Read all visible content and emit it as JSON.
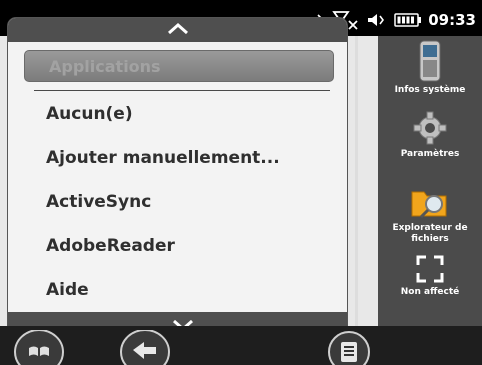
{
  "status_bar": {
    "time": "09:33",
    "icons": [
      "sync-icon",
      "signal-off-icon",
      "volume-icon",
      "battery-icon"
    ]
  },
  "tiles": [
    {
      "label": "Infos système",
      "icon": "device-icon"
    },
    {
      "label": "Paramètres",
      "icon": "gear-icon"
    },
    {
      "label": "Explorateur de fichiers",
      "icon": "folder-search-icon"
    },
    {
      "label": "Non affecté",
      "icon": "unassigned-frame-icon"
    }
  ],
  "menu": {
    "header": "Applications",
    "items": [
      "Aucun(e)",
      "Ajouter manuellement...",
      "ActiveSync",
      "AdobeReader",
      "Aide"
    ]
  },
  "taskbar": {
    "buttons": [
      "windows-start-icon",
      "back-icon",
      "menu-list-icon"
    ]
  },
  "colors": {
    "menu_background": "#f3f3f3",
    "strip": "#4f4f4f",
    "tile_column": "#4b4b4b",
    "home_background": "#e8e8e8"
  }
}
